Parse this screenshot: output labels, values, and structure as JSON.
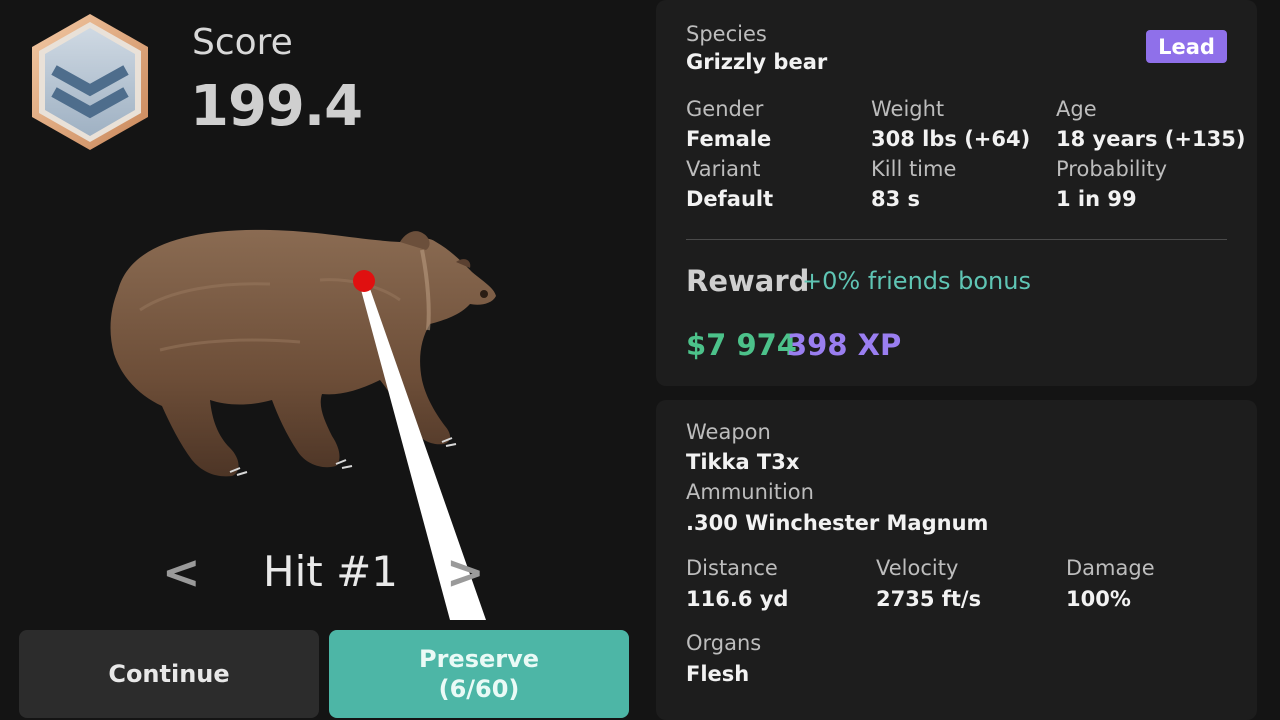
{
  "score": {
    "label": "Score",
    "value": "199.4"
  },
  "hit_nav": {
    "prev": "<",
    "label": "Hit #1",
    "next": ">"
  },
  "buttons": {
    "continue": "Continue",
    "preserve": "Preserve",
    "preserve_count": "(6/60)"
  },
  "animal": {
    "species_label": "Species",
    "species": "Grizzly bear",
    "badge": "Lead",
    "gender_label": "Gender",
    "gender": "Female",
    "weight_label": "Weight",
    "weight": "308 lbs (+64)",
    "age_label": "Age",
    "age": "18 years (+135)",
    "variant_label": "Variant",
    "variant": "Default",
    "kill_time_label": "Kill time",
    "kill_time": "83 s",
    "probability_label": "Probability",
    "probability": "1 in 99"
  },
  "reward": {
    "title": "Reward",
    "bonus": "+0% friends bonus",
    "money": "$7 974",
    "xp": "398 XP"
  },
  "shot": {
    "weapon_label": "Weapon",
    "weapon": "Tikka T3x",
    "ammo_label": "Ammunition",
    "ammo": ".300 Winchester Magnum",
    "distance_label": "Distance",
    "distance": "116.6 yd",
    "velocity_label": "Velocity",
    "velocity": "2735 ft/s",
    "damage_label": "Damage",
    "damage": "100%",
    "organs_label": "Organs",
    "organs": "Flesh"
  },
  "icons": {
    "rank": "rank-chevron-icon",
    "hit_marker": "hit-marker-icon"
  },
  "colors": {
    "background": "#141414",
    "panel": "#1d1d1d",
    "accent_teal": "#4db6a6",
    "lead_badge": "#8f70ea",
    "money": "#4cc28a",
    "xp": "#9a7ef0",
    "hit_marker": "#e01010"
  }
}
